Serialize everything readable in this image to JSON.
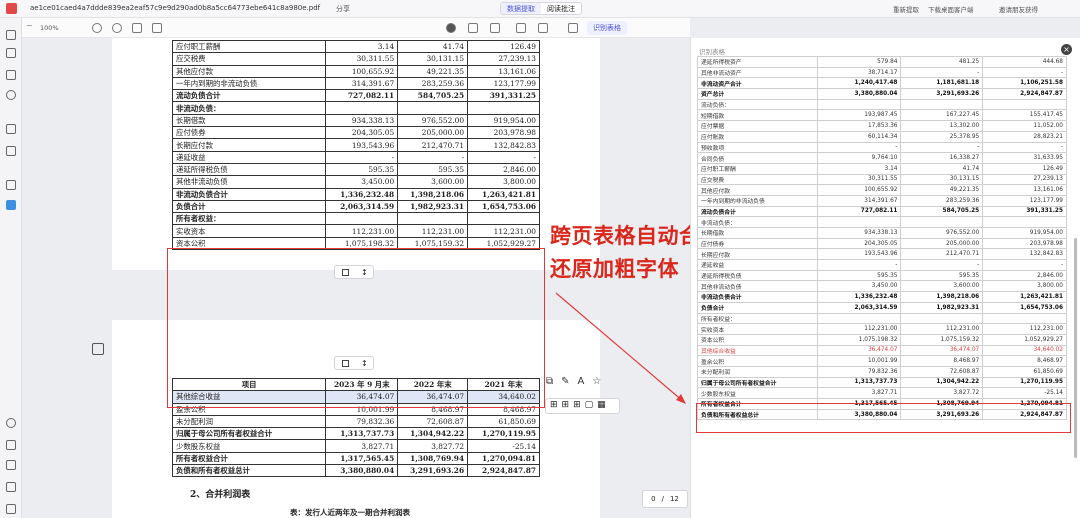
{
  "topbar": {
    "filename": "ae1ce01caed4a7ddde839ea2eaf57c9e9d290ad0b8a5cc64773ebe641c8a980e.pdf",
    "share": "分享",
    "mode_left": "数据提取",
    "mode_right": "阅读批注",
    "right_links": [
      "重新提取",
      "下载桌面客户端",
      "邀请朋友获得"
    ]
  },
  "toolbar": {
    "zoom": "100%",
    "ocr_button": "识别表格"
  },
  "annotation": {
    "line1": "跨页表格自动合并，",
    "line2": "还原加粗字体"
  },
  "page1_rows": [
    {
      "label": "应付职工薪酬",
      "v1": "3.14",
      "v2": "41.74",
      "v3": "126.49",
      "bold": false
    },
    {
      "label": "应交税费",
      "v1": "30,311.55",
      "v2": "30,131.15",
      "v3": "27,239.13",
      "bold": false
    },
    {
      "label": "其他应付款",
      "v1": "100,655.92",
      "v2": "49,221.35",
      "v3": "13,161.06",
      "bold": false
    },
    {
      "label": "一年内到期的非流动负债",
      "v1": "314,391.67",
      "v2": "283,259.36",
      "v3": "123,177.99",
      "bold": false
    },
    {
      "label": "流动负债合计",
      "v1": "727,082.11",
      "v2": "584,705.25",
      "v3": "391,331.25",
      "bold": true
    },
    {
      "label": "非流动负债：",
      "v1": "",
      "v2": "",
      "v3": "",
      "bold": true
    },
    {
      "label": "长期借款",
      "v1": "934,338.13",
      "v2": "976,552.00",
      "v3": "919,954.00",
      "bold": false
    },
    {
      "label": "应付债券",
      "v1": "204,305.05",
      "v2": "205,000.00",
      "v3": "203,978.98",
      "bold": false
    },
    {
      "label": "长期应付款",
      "v1": "193,543.96",
      "v2": "212,470.71",
      "v3": "132,842.83",
      "bold": false
    },
    {
      "label": "递延收益",
      "v1": "-",
      "v2": "-",
      "v3": "-",
      "bold": false
    },
    {
      "label": "递延所得税负债",
      "v1": "595.35",
      "v2": "595.35",
      "v3": "2,846.00",
      "bold": false
    },
    {
      "label": "其他非流动负债",
      "v1": "3,450.00",
      "v2": "3,600.00",
      "v3": "3,800.00",
      "bold": false
    },
    {
      "label": "非流动负债合计",
      "v1": "1,336,232.48",
      "v2": "1,398,218.06",
      "v3": "1,263,421.81",
      "bold": true
    },
    {
      "label": "负债合计",
      "v1": "2,063,314.59",
      "v2": "1,982,923.31",
      "v3": "1,654,753.06",
      "bold": true
    },
    {
      "label": "所有者权益：",
      "v1": "",
      "v2": "",
      "v3": "",
      "bold": true
    },
    {
      "label": "实收资本",
      "v1": "112,231.00",
      "v2": "112,231.00",
      "v3": "112,231.00",
      "bold": false
    },
    {
      "label": "资本公积",
      "v1": "1,075,198.32",
      "v2": "1,075,159.32",
      "v3": "1,052,929.27",
      "bold": false
    }
  ],
  "page2_header": {
    "c0": "项目",
    "c1": "2023 年 9 月末",
    "c2": "2022 年末",
    "c3": "2021 年末"
  },
  "page2_rows": [
    {
      "label": "其他综合收益",
      "v1": "36,474.07",
      "v2": "36,474.07",
      "v3": "34,640.02",
      "bold": false
    },
    {
      "label": "盈余公积",
      "v1": "10,001.99",
      "v2": "8,468.97",
      "v3": "8,468.97",
      "bold": false
    },
    {
      "label": "未分配利润",
      "v1": "79,832.36",
      "v2": "72,608.87",
      "v3": "61,850.69",
      "bold": false
    },
    {
      "label": "归属于母公司所有者权益合计",
      "v1": "1,313,737.73",
      "v2": "1,304,942.22",
      "v3": "1,270,119.95",
      "bold": true
    },
    {
      "label": "少数股东权益",
      "v1": "3,827.71",
      "v2": "3,827.72",
      "v3": "-25.14",
      "bold": false
    },
    {
      "label": "所有者权益合计",
      "v1": "1,317,565.45",
      "v2": "1,308,769.94",
      "v3": "1,270,094.81",
      "bold": true
    },
    {
      "label": "负债和所有者权益总计",
      "v1": "3,380,880.04",
      "v2": "3,291,693.26",
      "v3": "2,924,847.87",
      "bold": true
    }
  ],
  "page2_headings": {
    "h1": "2、合并利润表",
    "h2": "表：发行人近两年及一期合并利润表"
  },
  "pager": {
    "current": "0",
    "total": "12"
  },
  "right_panel": {
    "title": "识别表格",
    "rows": [
      {
        "label": "递延所得税资产",
        "v1": "579.84",
        "v2": "481.25",
        "v3": "444.68",
        "bold": false,
        "red": false
      },
      {
        "label": "其他非流动资产",
        "v1": "38,714.17",
        "v2": "-",
        "v3": "-",
        "bold": false,
        "red": false
      },
      {
        "label": "非流动资产合计",
        "v1": "1,240,417.48",
        "v2": "1,181,681.18",
        "v3": "1,106,251.58",
        "bold": true,
        "red": false
      },
      {
        "label": "资产总计",
        "v1": "3,380,880.04",
        "v2": "3,291,693.26",
        "v3": "2,924,847.87",
        "bold": true,
        "red": false
      },
      {
        "label": "流动负债：",
        "v1": "",
        "v2": "",
        "v3": "",
        "bold": false,
        "red": false
      },
      {
        "label": "短期借款",
        "v1": "193,987.45",
        "v2": "167,227.45",
        "v3": "155,417.45",
        "bold": false,
        "red": false
      },
      {
        "label": "应付票据",
        "v1": "17,853.36",
        "v2": "13,302.00",
        "v3": "11,052.00",
        "bold": false,
        "red": false
      },
      {
        "label": "应付账款",
        "v1": "60,114.34",
        "v2": "25,378.95",
        "v3": "28,823.21",
        "bold": false,
        "red": false
      },
      {
        "label": "预收款项",
        "v1": "-",
        "v2": "-",
        "v3": "-",
        "bold": false,
        "red": false
      },
      {
        "label": "合同负债",
        "v1": "9,764.10",
        "v2": "16,338.27",
        "v3": "31,633.95",
        "bold": false,
        "red": false
      },
      {
        "label": "应付职工薪酬",
        "v1": "3.14",
        "v2": "41.74",
        "v3": "126.49",
        "bold": false,
        "red": false
      },
      {
        "label": "应交税费",
        "v1": "30,311.55",
        "v2": "30,131.15",
        "v3": "27,239.13",
        "bold": false,
        "red": false
      },
      {
        "label": "其他应付款",
        "v1": "100,655.92",
        "v2": "49,221.35",
        "v3": "13,161.06",
        "bold": false,
        "red": false
      },
      {
        "label": "一年内到期的非流动负债",
        "v1": "314,391.67",
        "v2": "283,259.36",
        "v3": "123,177.99",
        "bold": false,
        "red": false
      },
      {
        "label": "流动负债合计",
        "v1": "727,082.11",
        "v2": "584,705.25",
        "v3": "391,331.25",
        "bold": true,
        "red": false
      },
      {
        "label": "非流动负债：",
        "v1": "",
        "v2": "",
        "v3": "",
        "bold": false,
        "red": false
      },
      {
        "label": "长期借款",
        "v1": "934,338.13",
        "v2": "976,552.00",
        "v3": "919,954.00",
        "bold": false,
        "red": false
      },
      {
        "label": "应付债券",
        "v1": "204,305.05",
        "v2": "205,000.00",
        "v3": "203,978.98",
        "bold": false,
        "red": false
      },
      {
        "label": "长期应付款",
        "v1": "193,543.96",
        "v2": "212,470.71",
        "v3": "132,842.83",
        "bold": false,
        "red": false
      },
      {
        "label": "递延收益",
        "v1": "-",
        "v2": "-",
        "v3": "-",
        "bold": false,
        "red": false
      },
      {
        "label": "递延所得税负债",
        "v1": "595.35",
        "v2": "595.35",
        "v3": "2,846.00",
        "bold": false,
        "red": false
      },
      {
        "label": "其他非流动负债",
        "v1": "3,450.00",
        "v2": "3,600.00",
        "v3": "3,800.00",
        "bold": false,
        "red": false
      },
      {
        "label": "非流动负债合计",
        "v1": "1,336,232.48",
        "v2": "1,398,218.06",
        "v3": "1,263,421.81",
        "bold": true,
        "red": false
      },
      {
        "label": "负债合计",
        "v1": "2,063,314.59",
        "v2": "1,982,923.31",
        "v3": "1,654,753.06",
        "bold": true,
        "red": false
      },
      {
        "label": "所有者权益：",
        "v1": "",
        "v2": "",
        "v3": "",
        "bold": false,
        "red": false
      },
      {
        "label": "实收资本",
        "v1": "112,231.00",
        "v2": "112,231.00",
        "v3": "112,231.00",
        "bold": false,
        "red": false
      },
      {
        "label": "资本公积",
        "v1": "1,075,198.32",
        "v2": "1,075,159.32",
        "v3": "1,052,929.27",
        "bold": false,
        "red": false
      },
      {
        "label": "其他综合收益",
        "v1": "36,474.07",
        "v2": "36,474.07",
        "v3": "34,640.02",
        "bold": false,
        "red": true
      },
      {
        "label": "盈余公积",
        "v1": "10,001.99",
        "v2": "8,468.97",
        "v3": "8,468.97",
        "bold": false,
        "red": false
      },
      {
        "label": "未分配利润",
        "v1": "79,832.36",
        "v2": "72,608.87",
        "v3": "61,850.69",
        "bold": false,
        "red": false
      },
      {
        "label": "归属于母公司所有者权益合计",
        "v1": "1,313,737.73",
        "v2": "1,304,942.22",
        "v3": "1,270,119.95",
        "bold": true,
        "red": false
      },
      {
        "label": "少数股东权益",
        "v1": "3,827.71",
        "v2": "3,827.72",
        "v3": "-25.14",
        "bold": false,
        "red": false
      },
      {
        "label": "所有者权益合计",
        "v1": "1,317,565.45",
        "v2": "1,308,769.94",
        "v3": "1,270,094.81",
        "bold": true,
        "red": false
      },
      {
        "label": "负债和所有者权益总计",
        "v1": "3,380,880.04",
        "v2": "3,291,693.26",
        "v3": "2,924,847.87",
        "bold": true,
        "red": false
      }
    ]
  },
  "colors": {
    "accent": "#4a54d6",
    "annotation": "#d9271c"
  }
}
